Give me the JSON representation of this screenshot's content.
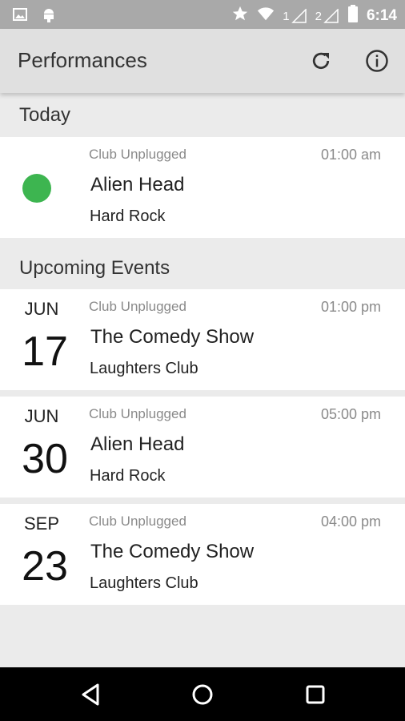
{
  "status_bar": {
    "sim1": "1",
    "sim2": "2",
    "time": "6:14"
  },
  "app_bar": {
    "title": "Performances",
    "actions": [
      "refresh-icon",
      "info-icon"
    ]
  },
  "sections": {
    "today": {
      "header": "Today",
      "events": [
        {
          "venue": "Club Unplugged",
          "time": "01:00 am",
          "title": "Alien Head",
          "place": "Hard Rock",
          "status_color": "#3db550"
        }
      ]
    },
    "upcoming": {
      "header": "Upcoming Events",
      "events": [
        {
          "month": "JUN",
          "day": "17",
          "venue": "Club Unplugged",
          "time": "01:00 pm",
          "title": "The Comedy Show",
          "place": "Laughters Club"
        },
        {
          "month": "JUN",
          "day": "30",
          "venue": "Club Unplugged",
          "time": "05:00 pm",
          "title": "Alien Head",
          "place": "Hard Rock"
        },
        {
          "month": "SEP",
          "day": "23",
          "venue": "Club Unplugged",
          "time": "04:00 pm",
          "title": "The Comedy Show",
          "place": "Laughters Club"
        }
      ]
    }
  },
  "nav_bar": {
    "buttons": [
      "back-icon",
      "home-icon",
      "recents-icon"
    ]
  },
  "colors": {
    "status_bar": "#a9a9a9",
    "app_bar": "#e0e0e0",
    "background": "#ebebeb",
    "card": "#ffffff",
    "live": "#3db550"
  }
}
